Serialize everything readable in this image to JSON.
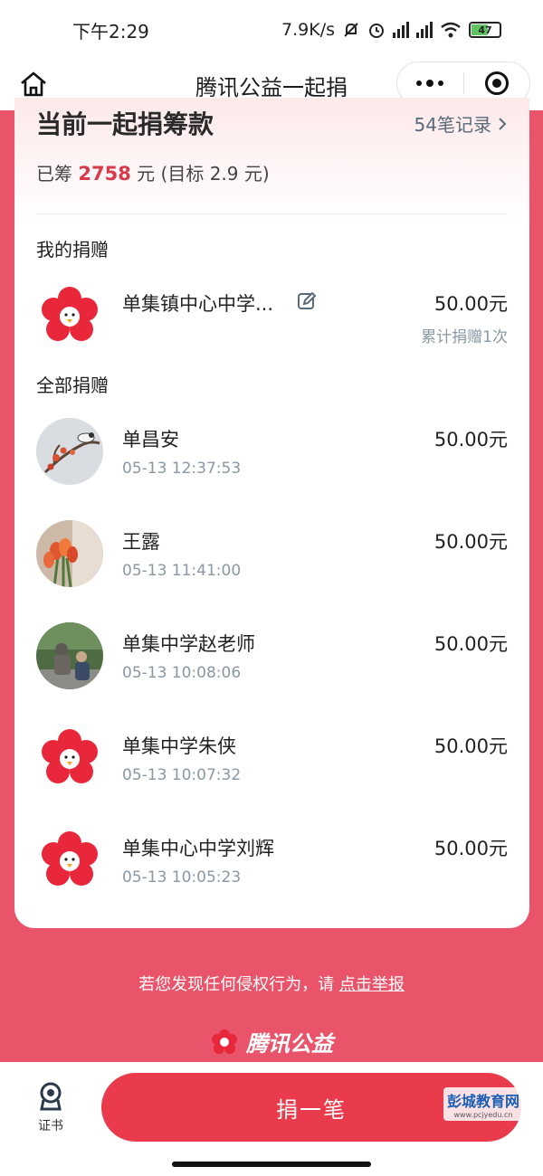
{
  "status_bar": {
    "time": "下午2:29",
    "net_speed": "7.9K/s",
    "battery": "47"
  },
  "nav": {
    "title": "腾讯公益一起捐"
  },
  "summary": {
    "heading": "当前一起捐筹款",
    "records_link": "54笔记录",
    "raised_prefix": "已筹",
    "raised_amount": "2758",
    "raised_suffix": "元 (目标 2.9 元)"
  },
  "my_donation": {
    "section_label": "我的捐赠",
    "name": "单集镇中心中学...",
    "amount": "50.00元",
    "cumulative": "累计捐赠1次"
  },
  "all_donations": {
    "section_label": "全部捐赠",
    "items": [
      {
        "name": "单昌安",
        "time": "05-13 12:37:53",
        "amount": "50.00元",
        "avatar": "bird-branch-photo"
      },
      {
        "name": "王露",
        "time": "05-13 11:41:00",
        "amount": "50.00元",
        "avatar": "tulip-photo"
      },
      {
        "name": "单集中学赵老师",
        "time": "05-13 10:08:06",
        "amount": "50.00元",
        "avatar": "people-statue-photo"
      },
      {
        "name": "单集中学朱侠",
        "time": "05-13 10:07:32",
        "amount": "50.00元",
        "avatar": "red-flower-logo"
      },
      {
        "name": "单集中心中学刘辉",
        "time": "05-13 10:05:23",
        "amount": "50.00元",
        "avatar": "red-flower-logo"
      }
    ]
  },
  "footer": {
    "report_text": "若您发现任何侵权行为，请",
    "report_link": "点击举报",
    "brand": "腾讯公益"
  },
  "bottom_bar": {
    "cert_label": "证书",
    "donate_button": "捐一笔",
    "watermark": "彭城教育网",
    "watermark_url": "www.pcjyedu.cn"
  },
  "colors": {
    "accent": "#ea3b4c",
    "page_bg": "#e9546a",
    "muted": "#8a97a4"
  }
}
